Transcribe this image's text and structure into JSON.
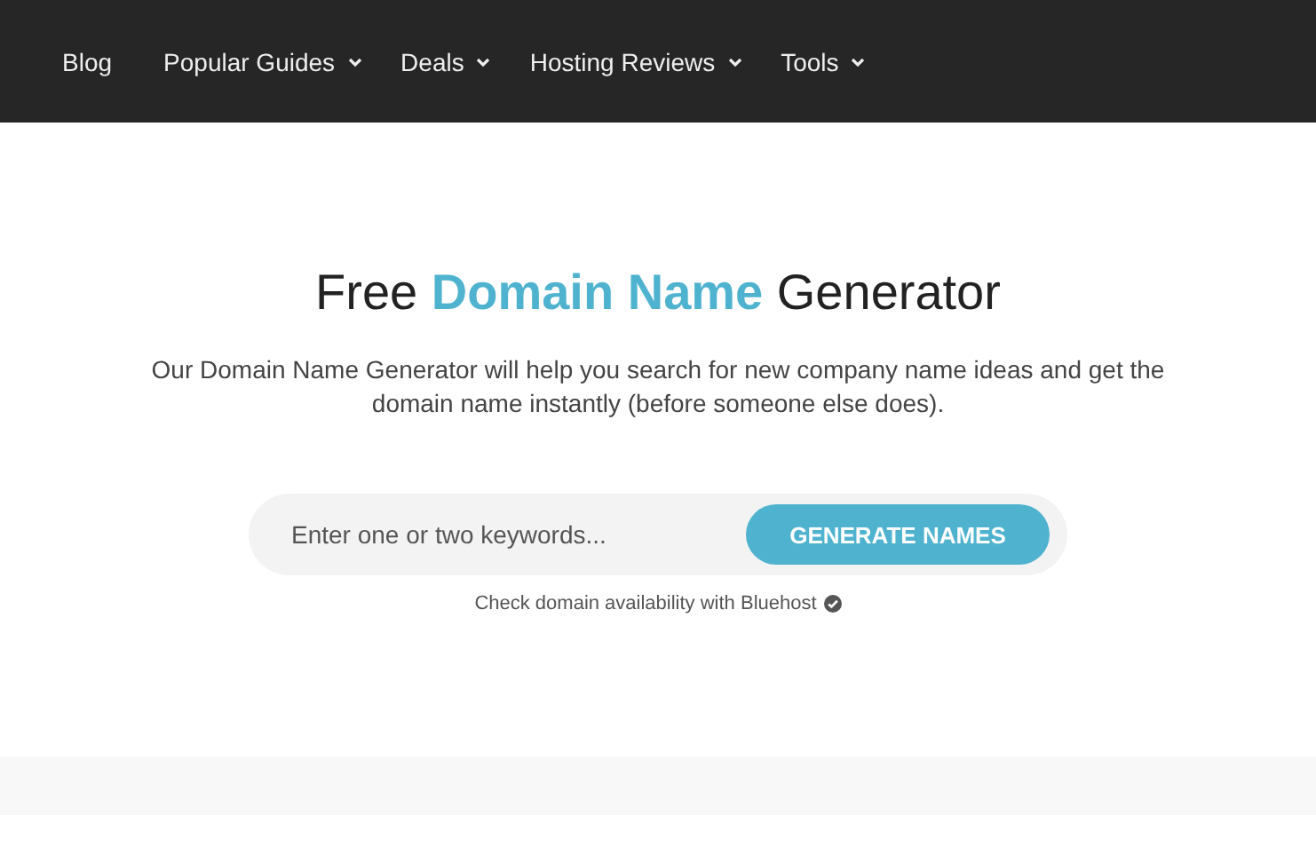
{
  "nav": [
    {
      "label": "Blog",
      "dropdown": false
    },
    {
      "label": "Popular Guides",
      "dropdown": true
    },
    {
      "label": "Deals",
      "dropdown": true
    },
    {
      "label": "Hosting Reviews",
      "dropdown": true
    },
    {
      "label": "Tools",
      "dropdown": true
    }
  ],
  "hero": {
    "title": [
      {
        "text": "Free ",
        "highlight": false
      },
      {
        "text": "Domain Name",
        "highlight": true
      },
      {
        "text": " Generator",
        "highlight": false
      }
    ],
    "description": "Our Domain Name Generator will help you search for new company name ideas and get the domain name instantly (before someone else does).",
    "search": {
      "placeholder": "Enter one or two keywords..."
    },
    "button": "GENERATE NAMES",
    "note": "Check domain availability with Bluehost"
  }
}
